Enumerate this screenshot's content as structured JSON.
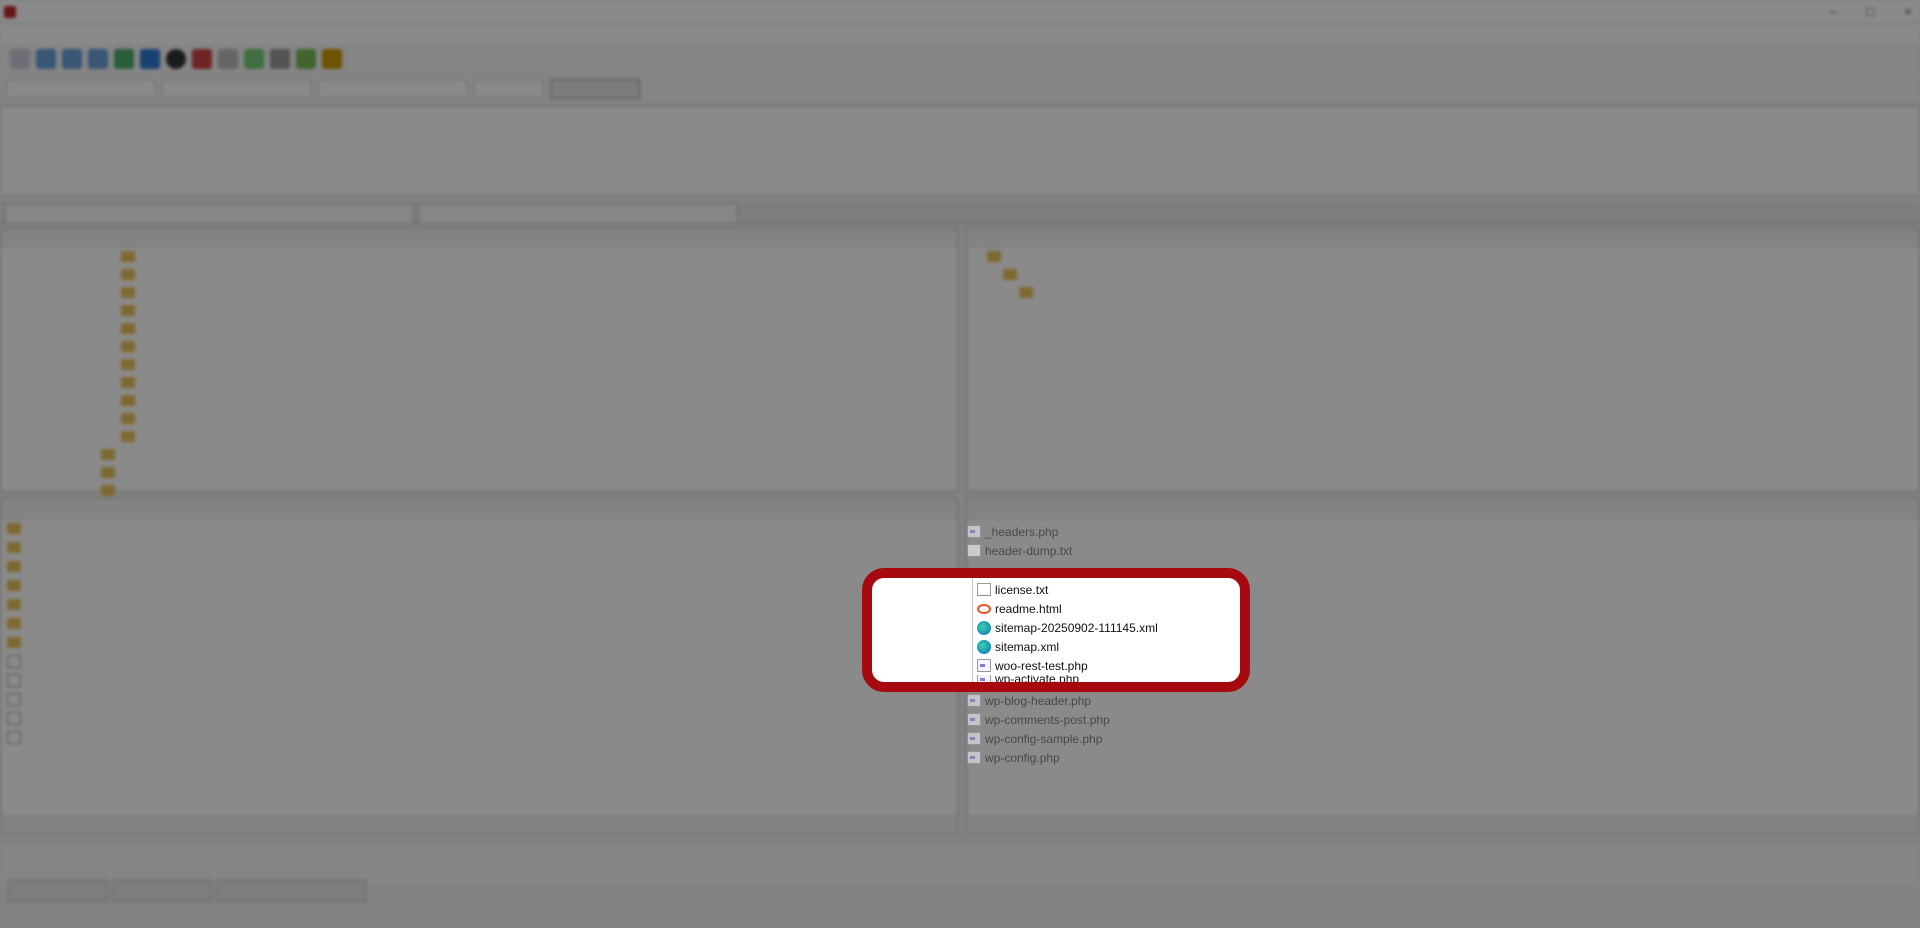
{
  "local_tree": [
    "",
    "",
    "",
    "",
    "",
    "",
    "",
    "",
    "",
    "",
    "",
    "",
    "",
    ""
  ],
  "highlighted_files": [
    {
      "name": "license.txt",
      "icon": "text-file-icon"
    },
    {
      "name": "readme.html",
      "icon": "html-file-icon"
    },
    {
      "name": "sitemap-20250902-111145.xml",
      "icon": "xml-file-icon"
    },
    {
      "name": "sitemap.xml",
      "icon": "xml-file-icon"
    },
    {
      "name": "woo-rest-test.php",
      "icon": "php-file-icon"
    },
    {
      "name": "wp-activate.php",
      "icon": "php-file-icon"
    }
  ],
  "remote_files_above": [
    {
      "name": "_headers.php",
      "icon": "php-file-icon"
    },
    {
      "name": "header-dump.txt",
      "icon": "text-file-icon"
    }
  ],
  "remote_files_below": [
    {
      "name": "wp-blog-header.php",
      "icon": "php-file-icon"
    },
    {
      "name": "wp-comments-post.php",
      "icon": "php-file-icon"
    },
    {
      "name": "wp-config-sample.php",
      "icon": "php-file-icon"
    },
    {
      "name": "wp-config.php",
      "icon": "php-file-icon"
    }
  ],
  "colors": {
    "highlight_border": "#a6090f",
    "dim_overlay": "rgba(0,0,0,0.46)"
  }
}
